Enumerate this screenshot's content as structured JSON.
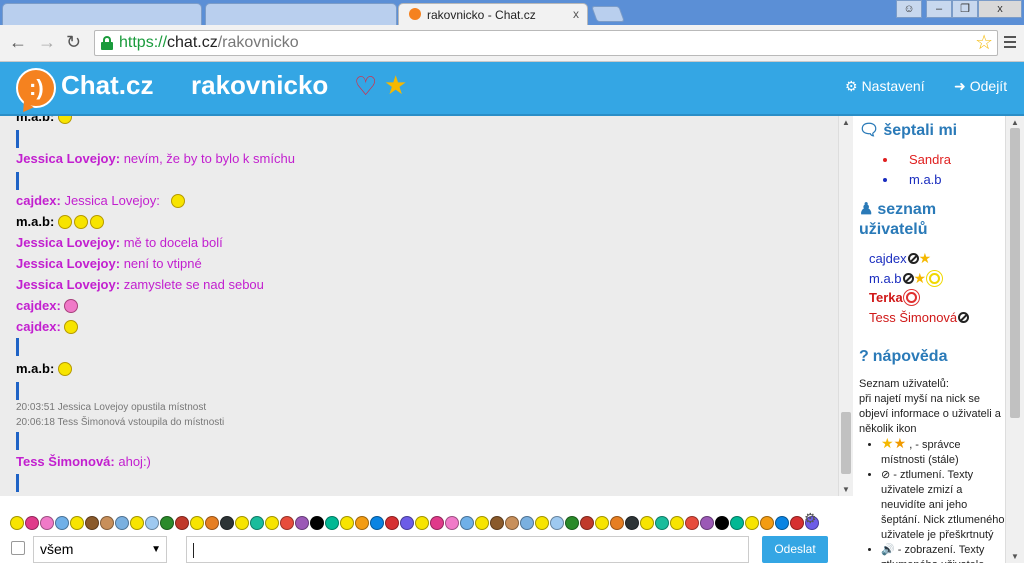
{
  "browser": {
    "tabs": [
      {
        "title": ""
      },
      {
        "title": ""
      },
      {
        "title": "rakovnicko - Chat.cz"
      }
    ],
    "close_glyph": "x",
    "url_proto": "https://",
    "url_host": "chat.cz",
    "url_path": "/rakovnicko",
    "window_buttons": [
      "person",
      "minimize",
      "restore",
      "x"
    ]
  },
  "header": {
    "logo": "Chat.cz",
    "logo_glyph": ":)",
    "room": "rakovnicko",
    "settings_label": "Nastavení",
    "logout_label": "Odejít",
    "icons": [
      "heart-icon",
      "star-icon",
      "gear-icon",
      "logout-icon"
    ]
  },
  "chat": {
    "messages": [
      {
        "nick": "m.a.b:",
        "text": "",
        "nick_color": "#111111",
        "text_color": "#111111"
      },
      {
        "nick": "Jessica Lovejoy:",
        "text": "nevím, že by to bylo k smíchu",
        "nick_color": "#c21fcf",
        "text_color": "#c21fcf"
      },
      {
        "nick": "cajdex:",
        "text": "Jessica Lovejoy:",
        "nick_color": "#c21fcf",
        "text_color": "#c21fcf"
      },
      {
        "nick": "m.a.b:",
        "text": "",
        "nick_color": "#111111",
        "text_color": "#111111"
      },
      {
        "nick": "Jessica Lovejoy:",
        "text": "mě to docela bolí",
        "nick_color": "#c21fcf",
        "text_color": "#c21fcf"
      },
      {
        "nick": "Jessica Lovejoy:",
        "text": "není to vtipné",
        "nick_color": "#c21fcf",
        "text_color": "#c21fcf"
      },
      {
        "nick": "Jessica Lovejoy:",
        "text": "zamyslete se nad sebou",
        "nick_color": "#c21fcf",
        "text_color": "#c21fcf"
      },
      {
        "nick": "cajdex:",
        "text": "",
        "nick_color": "#c21fcf",
        "text_color": "#c21fcf"
      },
      {
        "nick": "cajdex:",
        "text": "",
        "nick_color": "#c21fcf",
        "text_color": "#c21fcf"
      },
      {
        "nick": "m.a.b:",
        "text": "",
        "nick_color": "#111111",
        "text_color": "#111111"
      },
      {
        "nick": "Tess Šimonová:",
        "text": "ahoj:)",
        "nick_color": "#c21fcf",
        "text_color": "#c21fcf"
      }
    ],
    "system": [
      "20:03:51 Jessica Lovejoy opustila místnost",
      "20:06:18 Tess Šimonová vstoupila do místnosti"
    ]
  },
  "sidebar": {
    "whispers_title": "šeptali mi",
    "whispers": [
      {
        "name": "Sandra",
        "color": "#e02020"
      },
      {
        "name": "m.a.b",
        "color": "#1a2dbf"
      }
    ],
    "users_title_1": "seznam",
    "users_title_2": "uživatelů",
    "users": [
      {
        "name": "cajdex",
        "color": "#1a2dbf",
        "bold": false
      },
      {
        "name": "m.a.b",
        "color": "#1a2dbf",
        "bold": false
      },
      {
        "name": "Terka",
        "color": "#d01818",
        "bold": true
      },
      {
        "name": "Tess Šimonová",
        "color": "#d01818",
        "bold": false
      }
    ],
    "help_title": "nápověda",
    "help_intro": "Seznam uživatelů:\npři najetí myší na nick se objeví informace o uživateli a několik ikon",
    "help_items": [
      ", - správce místnosti (stále)",
      "- ztlumení. Texty uživatele zmizí a neuvidíte ani jeho šeptání. Nick ztlumeného uživatele je přeškrtnutý",
      "- zobrazení. Texty ztlumeného uživatele jsou"
    ]
  },
  "input": {
    "recipient": "všem",
    "message_value": "",
    "send_label": "Odeslat"
  }
}
